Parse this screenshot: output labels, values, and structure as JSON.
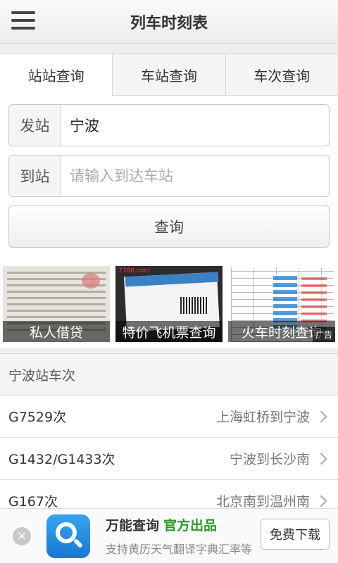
{
  "header": {
    "title": "列车时刻表",
    "menu_icon": "menu-icon"
  },
  "tabs": [
    {
      "label": "站站查询",
      "active": true
    },
    {
      "label": "车站查询",
      "active": false
    },
    {
      "label": "车次查询",
      "active": false
    }
  ],
  "form": {
    "from_label": "发站",
    "from_value": "宁波",
    "to_label": "到站",
    "to_placeholder": "请输入到达车站",
    "query_label": "查询"
  },
  "ads": [
    {
      "caption": "私人借贷"
    },
    {
      "caption": "特价飞机票查询",
      "logo": "7788.com"
    },
    {
      "caption": "火车时刻查询"
    }
  ],
  "ad_tag": "广告",
  "station_section": {
    "title": "宁波站车次",
    "trains": [
      {
        "number": "G7529次",
        "route": "上海虹桥到宁波"
      },
      {
        "number": "G1432/G1433次",
        "route": "宁波到长沙南"
      },
      {
        "number": "G167次",
        "route": "北京南到温州南"
      }
    ]
  },
  "bottom_ad": {
    "app_name": "万能查询",
    "official": "官方出品",
    "description": "支持黄历天气翻译字典汇率等",
    "download_label": "免费下载",
    "close_symbol": "×"
  },
  "colors": {
    "accent_green": "#2a9a2a",
    "app_blue": "#1878d0"
  }
}
